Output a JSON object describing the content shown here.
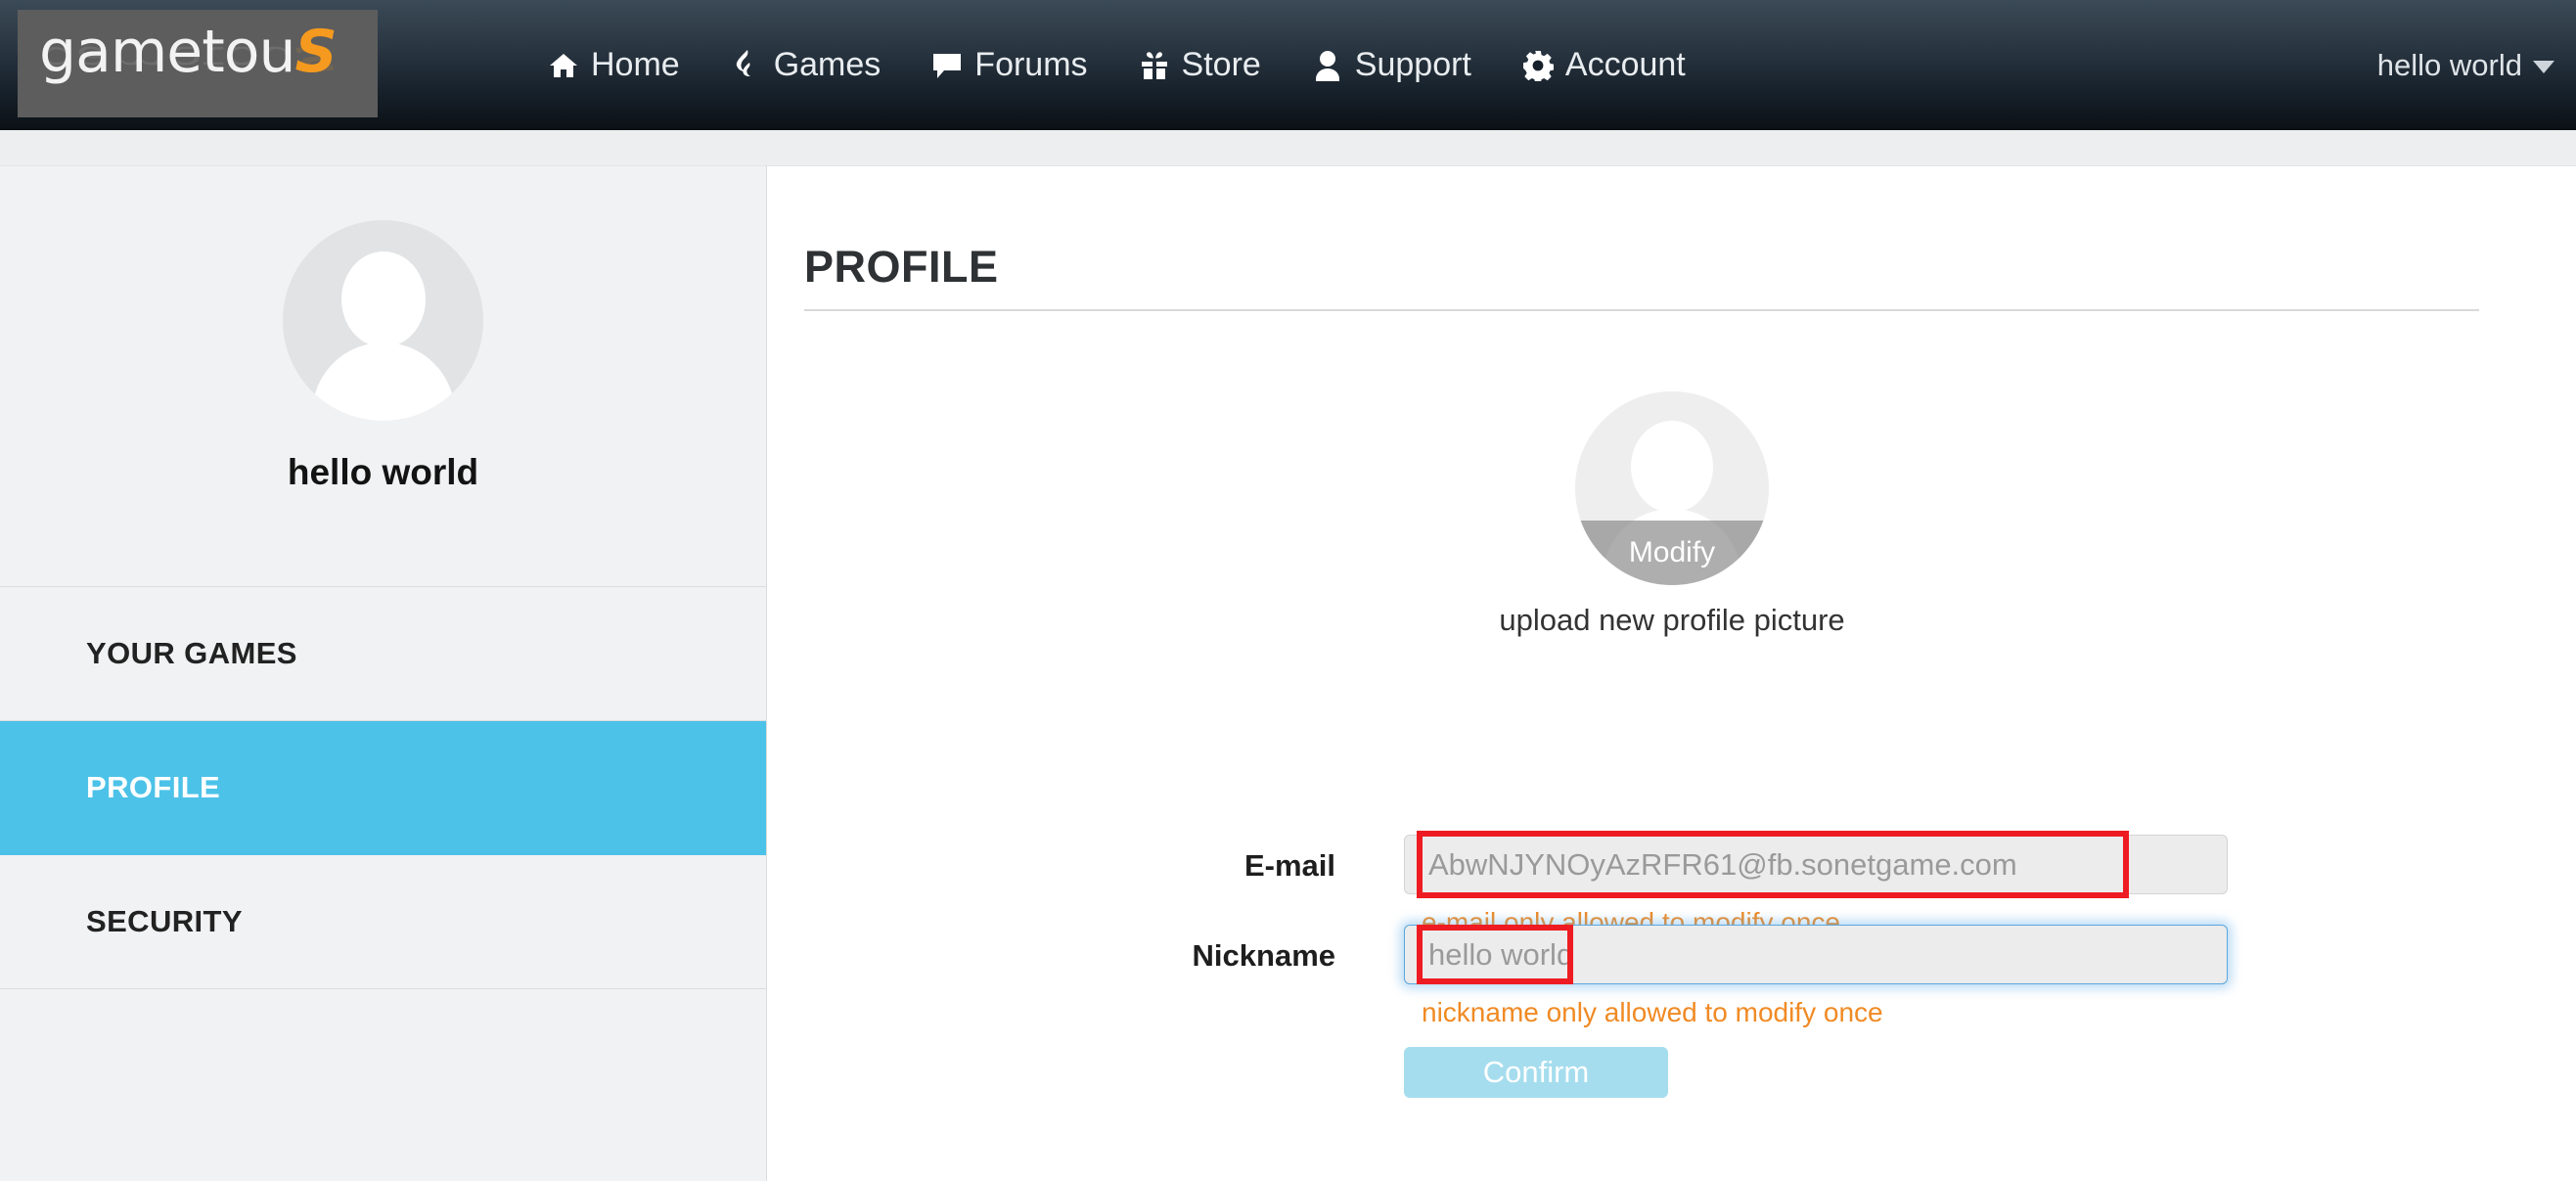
{
  "header": {
    "logo": {
      "text": "gametou",
      "swash": "S",
      "name": "gametous-logo"
    },
    "nav": [
      {
        "label": "Home",
        "icon": "home-icon"
      },
      {
        "label": "Games",
        "icon": "flame-icon"
      },
      {
        "label": "Forums",
        "icon": "comment-icon"
      },
      {
        "label": "Store",
        "icon": "gift-icon"
      },
      {
        "label": "Support",
        "icon": "user-icon"
      },
      {
        "label": "Account",
        "icon": "gear-icon"
      }
    ],
    "user_menu": {
      "label": "hello world",
      "caret": "chevron-down-icon"
    }
  },
  "sidebar": {
    "username": "hello world",
    "avatar_icon": "user-avatar-icon",
    "items": [
      {
        "label": "YOUR GAMES",
        "active": false
      },
      {
        "label": "PROFILE",
        "active": true
      },
      {
        "label": "SECURITY",
        "active": false
      }
    ]
  },
  "main": {
    "title": "PROFILE",
    "avatar": {
      "icon": "user-avatar-icon",
      "overlay_label": "Modify",
      "caption": "upload new profile picture"
    },
    "fields": [
      {
        "label": "E-mail",
        "value": "AbwNJYNOyAzRFR61@fb.sonetgame.com",
        "placeholder": "AbwNJYNOyAzRFR61@fb.sonetgame.com",
        "hint": "e-mail only allowed to modify once",
        "focused": false,
        "annotated": true
      },
      {
        "label": "Nickname",
        "value": "hello world",
        "placeholder": "hello world",
        "hint": "nickname only allowed to modify once",
        "focused": true,
        "annotated": true
      }
    ],
    "confirm_label": "Confirm"
  },
  "colors": {
    "accent_blue": "#4cc2e8",
    "button_blue": "#a5ddee",
    "hint_orange": "#f08a24",
    "annotation_red": "#ee1c22",
    "header_dark": "#16202a",
    "logo_orange": "#f59a1e"
  }
}
